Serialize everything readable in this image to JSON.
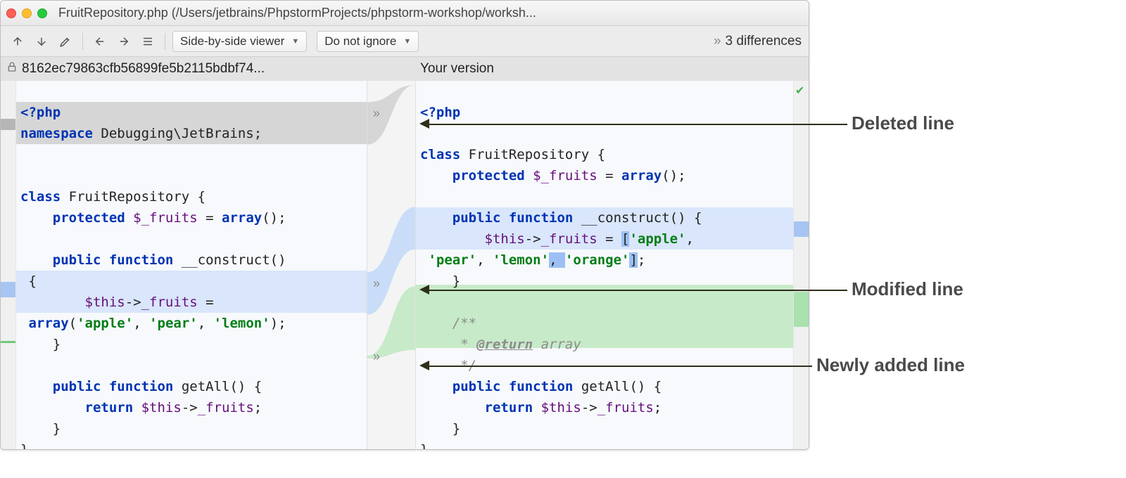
{
  "window": {
    "title": "FruitRepository.php (/Users/jetbrains/PhpstormProjects/phpstorm-workshop/worksh..."
  },
  "toolbar": {
    "viewer_mode": "Side-by-side viewer",
    "whitespace_mode": "Do not ignore",
    "diff_count": "3 differences"
  },
  "headers": {
    "left": "8162ec79863cfb56899fe5b2115bdbf74...",
    "right": "Your version"
  },
  "code_left": {
    "l1_open": "<?php",
    "l2": "namespace Debugging\\JetBrains;",
    "l5": "class FruitRepository {",
    "l6": "    protected $_fruits = array();",
    "l8": "    public function __construct()",
    "l9": " {",
    "l10": "        $this->_fruits = ",
    "l11": " array('apple', 'pear', 'lemon');",
    "l12": "    }",
    "l14": "    public function getAll() {",
    "l15": "        return $this->_fruits;",
    "l16": "    }",
    "l17": "}"
  },
  "code_right": {
    "l1_open": "<?php",
    "l3": "class FruitRepository {",
    "l4": "    protected $_fruits = array();",
    "l6": "    public function __construct() {",
    "l7a": "        $this->_fruits = ['apple',",
    "l7b": " 'pear', 'lemon', 'orange'];",
    "l8": "    }",
    "l10": "    /**",
    "l11": "     * @return array",
    "l12": "     */",
    "l13": "    public function getAll() {",
    "l14": "        return $this->_fruits;",
    "l15": "    }",
    "l16": "}"
  },
  "annotations": {
    "deleted": "Deleted line",
    "modified": "Modified line",
    "added": "Newly added line"
  }
}
